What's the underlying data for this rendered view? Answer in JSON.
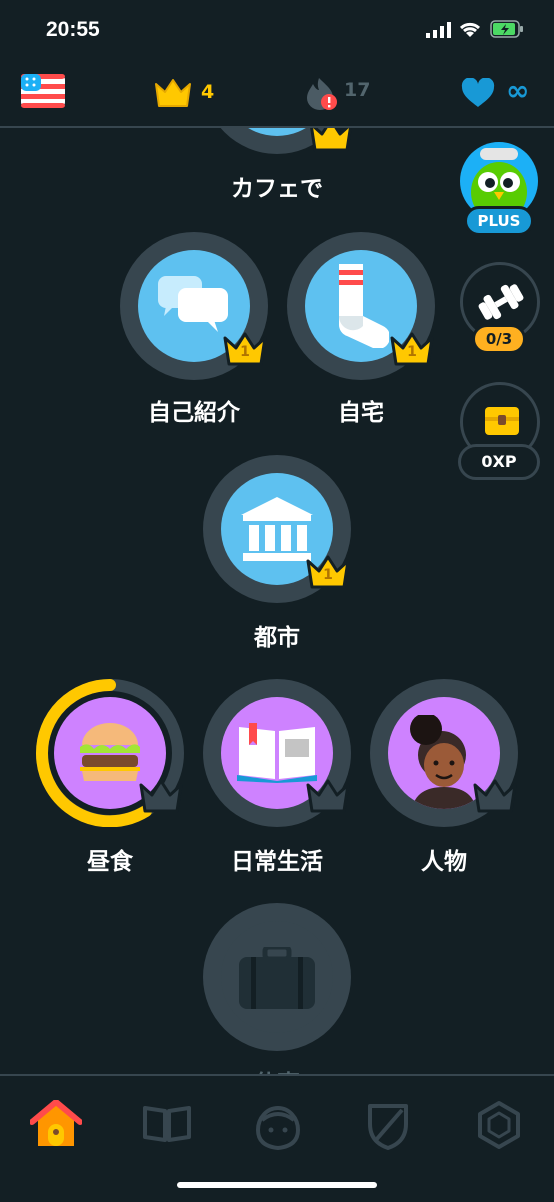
{
  "status_bar": {
    "time": "20:55"
  },
  "top_bar": {
    "language_flag": "us-flag-icon",
    "crowns": "4",
    "streak": "17",
    "hearts": "∞"
  },
  "skills": [
    {
      "id": "cafe",
      "label": "カフェで",
      "icon": "cafe-icon"
    },
    {
      "id": "intro",
      "label": "自己紹介",
      "icon": "speech-bubbles-icon",
      "crown_level": "1"
    },
    {
      "id": "home",
      "label": "自宅",
      "icon": "sock-icon",
      "crown_level": "1"
    },
    {
      "id": "city",
      "label": "都市",
      "icon": "building-icon",
      "crown_level": "1"
    },
    {
      "id": "lunch",
      "label": "昼食",
      "icon": "burger-icon"
    },
    {
      "id": "daily",
      "label": "日常生活",
      "icon": "book-icon"
    },
    {
      "id": "people",
      "label": "人物",
      "icon": "person-icon"
    },
    {
      "id": "locked",
      "label": "仕事",
      "icon": "suitcase-icon"
    }
  ],
  "right_rail": {
    "plus_label": "PLUS",
    "practice_count": "0/3",
    "xp_label": "0XP"
  },
  "bottom_nav": [
    {
      "id": "learn",
      "icon": "home-icon"
    },
    {
      "id": "stories",
      "icon": "book-icon"
    },
    {
      "id": "profile",
      "icon": "avatar-icon"
    },
    {
      "id": "leaderboard",
      "icon": "shield-icon"
    },
    {
      "id": "shop",
      "icon": "hexagon-icon"
    }
  ],
  "colors": {
    "background": "#131f24",
    "ring": "#37464f",
    "blue_skill": "#5ec1f0",
    "purple_skill": "#ce82ff",
    "gold": "#ffc800",
    "plus_blue": "#1cb0f6"
  }
}
